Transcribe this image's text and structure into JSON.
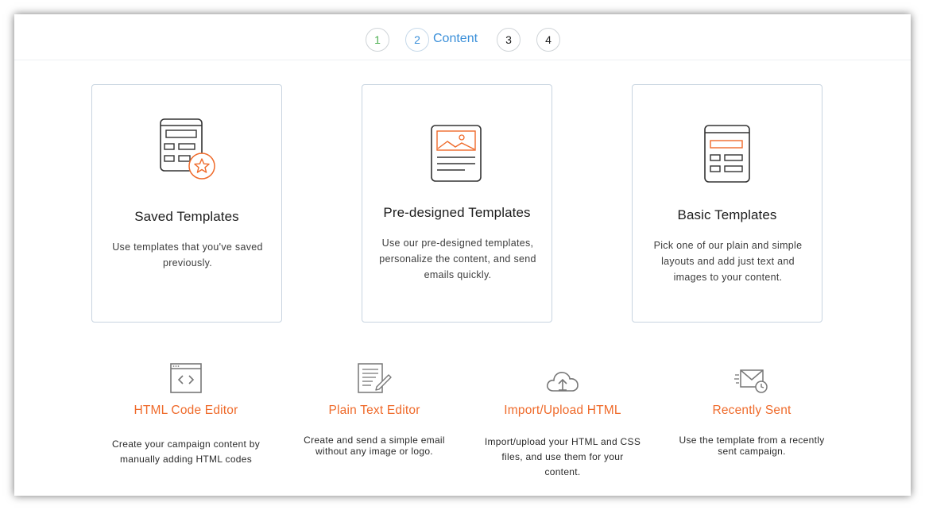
{
  "stepper": {
    "steps": [
      {
        "number": "1",
        "state": "done"
      },
      {
        "number": "2",
        "state": "active",
        "label": "Content"
      },
      {
        "number": "3",
        "state": "pending"
      },
      {
        "number": "4",
        "state": "pending"
      }
    ]
  },
  "cards": [
    {
      "title": "Saved Templates",
      "description": "Use templates that you've saved previously.",
      "icon": "saved-template-icon"
    },
    {
      "title": "Pre-designed Templates",
      "description": "Use our pre-designed templates, personalize the content, and send emails quickly.",
      "icon": "predesigned-template-icon"
    },
    {
      "title": "Basic Templates",
      "description": "Pick one of our plain and simple layouts and add just text and images to your content.",
      "icon": "basic-template-icon"
    }
  ],
  "options": [
    {
      "title": "HTML Code Editor",
      "description": "Create your campaign content by manually adding HTML codes",
      "icon": "code-editor-icon"
    },
    {
      "title": "Plain Text Editor",
      "description": "Create and send a simple email without any image or logo.",
      "icon": "text-editor-icon"
    },
    {
      "title": "Import/Upload HTML",
      "description": "Import/upload your HTML and CSS files, and use them for your content.",
      "icon": "cloud-upload-icon"
    },
    {
      "title": "Recently Sent",
      "description": "Use the template from a recently sent campaign.",
      "icon": "recent-mail-icon"
    }
  ],
  "colors": {
    "accent_orange": "#ef6a2a",
    "active_blue": "#3a8fd9",
    "done_green": "#4caf50",
    "card_border": "#c8d4e0"
  }
}
